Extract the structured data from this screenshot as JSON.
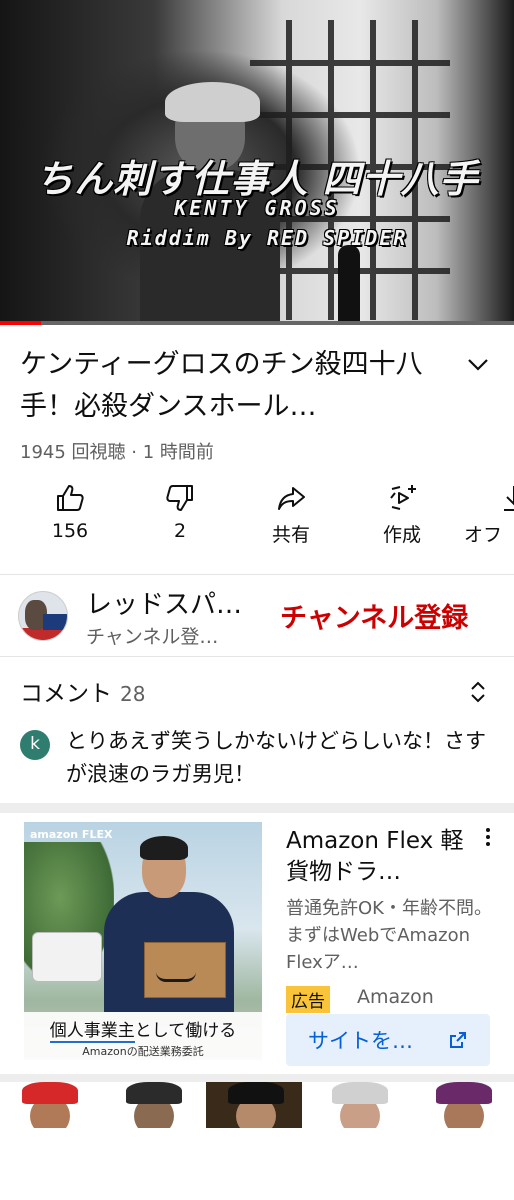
{
  "video": {
    "overlay_title": "ちん刺す仕事人 四十八手",
    "overlay_artist": "KENTY GROSS",
    "overlay_riddim": "Riddim By RED SPIDER",
    "progress_fraction": 0.08,
    "title": "ケンティーグロスのチン殺四十八手！必殺ダンスホール…",
    "views": "1945 回視聴",
    "separator": "·",
    "time_ago": "1 時間前"
  },
  "actions": [
    {
      "icon": "thumbs-up-icon",
      "label": "156"
    },
    {
      "icon": "thumbs-down-icon",
      "label": "2"
    },
    {
      "icon": "share-icon",
      "label": "共有"
    },
    {
      "icon": "create-icon",
      "label": "作成"
    },
    {
      "icon": "download-icon",
      "label": "オフ"
    }
  ],
  "channel": {
    "name": "レッドスパ…",
    "subscribers": "チャンネル登…",
    "subscribe_label": "チャンネル登録"
  },
  "comments": {
    "heading": "コメント",
    "count": "28",
    "top": {
      "avatar_letter": "k",
      "text": "とりあえず笑うしかないけどらしいな！さすが浪速のラガ男児！"
    }
  },
  "ad": {
    "brand_logo": "amazon FLEX",
    "caption_line1_highlight": "個人事業主",
    "caption_line1_rest": "として働ける",
    "caption_line2": "Amazonの配送業務委託",
    "title": "Amazon Flex 軽貨物ドラ…",
    "description": "普通免許OK・年齢不問。まずはWebでAmazon Flexア…",
    "badge": "広告",
    "advertiser": "Amazon",
    "cta_label": "サイトを…"
  },
  "colors": {
    "subscribe": "#cc0000",
    "progress": "#ff0000",
    "cta_text": "#065fd4",
    "ad_badge": "#f9c33a"
  }
}
